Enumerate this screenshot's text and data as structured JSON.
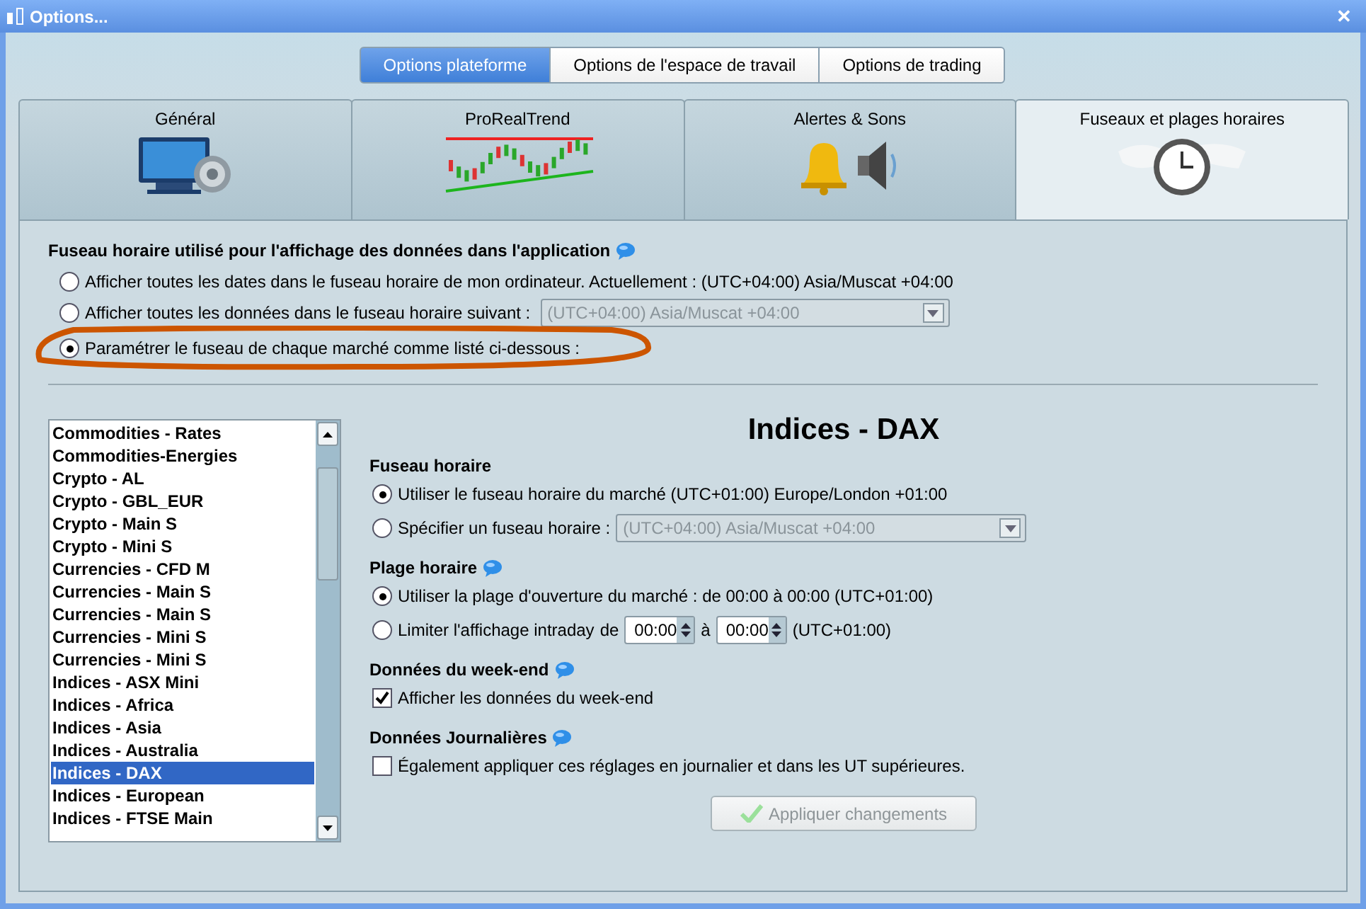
{
  "window": {
    "title": "Options...",
    "close": "✕"
  },
  "platform_tabs": [
    {
      "label": "Options plateforme",
      "selected": true
    },
    {
      "label": "Options de l'espace de travail",
      "selected": false
    },
    {
      "label": "Options de trading",
      "selected": false
    }
  ],
  "category_tabs": [
    {
      "label": "Général",
      "selected": false,
      "kind": "computer"
    },
    {
      "label": "ProRealTrend",
      "selected": false,
      "kind": "trend"
    },
    {
      "label": "Alertes & Sons",
      "selected": false,
      "kind": "sound"
    },
    {
      "label": "Fuseaux et plages horaires",
      "selected": true,
      "kind": "clock"
    }
  ],
  "timezone_section": {
    "heading": "Fuseau horaire utilisé pour l'affichage des données dans l'application",
    "info": true,
    "options": [
      {
        "label": "Afficher toutes les dates dans le fuseau horaire de mon ordinateur. Actuellement : (UTC+04:00) Asia/Muscat +04:00",
        "selected": false
      },
      {
        "label": "Afficher toutes les données dans le fuseau horaire suivant :",
        "selected": false,
        "dropdown": {
          "value": "(UTC+04:00) Asia/Muscat +04:00",
          "disabled": true
        }
      },
      {
        "label": "Paramétrer le fuseau de chaque marché comme listé ci-dessous :",
        "selected": true,
        "annotation": {
          "kind": "ellipse",
          "color": "#cc5500"
        }
      }
    ]
  },
  "market_list": {
    "items": [
      {
        "label": "Commodities - Rates",
        "selected": false
      },
      {
        "label": "Commodities-Energies",
        "selected": false
      },
      {
        "label": "Crypto - AL",
        "selected": false
      },
      {
        "label": "Crypto - GBL_EUR",
        "selected": false
      },
      {
        "label": "Crypto - Main S",
        "selected": false
      },
      {
        "label": "Crypto - Mini S",
        "selected": false
      },
      {
        "label": "Currencies - CFD M",
        "selected": false
      },
      {
        "label": "Currencies - Main S",
        "selected": false
      },
      {
        "label": "Currencies - Main S",
        "selected": false
      },
      {
        "label": "Currencies - Mini S",
        "selected": false
      },
      {
        "label": "Currencies - Mini S",
        "selected": false
      },
      {
        "label": "Indices - ASX Mini",
        "selected": false
      },
      {
        "label": "Indices - Africa",
        "selected": false
      },
      {
        "label": "Indices - Asia",
        "selected": false
      },
      {
        "label": "Indices - Australia",
        "selected": false
      },
      {
        "label": "Indices - DAX",
        "selected": true
      },
      {
        "label": "Indices - European",
        "selected": false
      },
      {
        "label": "Indices - FTSE Main",
        "selected": false
      }
    ]
  },
  "detail": {
    "title": "Indices - DAX",
    "sections": [
      {
        "heading": "Fuseau horaire",
        "controls": [
          {
            "kind": "radio",
            "selected": true,
            "parts": [
              {
                "kind": "text",
                "text": "Utiliser le fuseau horaire du marché (UTC+01:00) Europe/London +01:00"
              }
            ]
          },
          {
            "kind": "radio",
            "selected": false,
            "parts": [
              {
                "kind": "text",
                "text": "Spécifier un fuseau horaire :"
              },
              {
                "kind": "dropdown",
                "value": "(UTC+04:00) Asia/Muscat +04:00",
                "disabled": true
              }
            ]
          }
        ]
      },
      {
        "heading": "Plage horaire",
        "info": true,
        "controls": [
          {
            "kind": "radio",
            "selected": true,
            "parts": [
              {
                "kind": "text",
                "text": "Utiliser la plage d'ouverture du marché : de 00:00 à 00:00  (UTC+01:00)"
              }
            ]
          },
          {
            "kind": "radio",
            "selected": false,
            "parts": [
              {
                "kind": "text",
                "text": "Limiter l'affichage intraday"
              },
              {
                "kind": "text",
                "text": "de"
              },
              {
                "kind": "spinner",
                "value": "00:00"
              },
              {
                "kind": "text",
                "text": "à"
              },
              {
                "kind": "spinner",
                "value": "00:00"
              },
              {
                "kind": "text",
                "text": "(UTC+01:00)"
              }
            ]
          }
        ]
      },
      {
        "heading": "Données du week-end",
        "info": true,
        "controls": [
          {
            "kind": "checkbox",
            "checked": true,
            "parts": [
              {
                "kind": "text",
                "text": "Afficher les données du week-end"
              }
            ]
          }
        ]
      },
      {
        "heading": "Données Journalières",
        "info": true,
        "controls": [
          {
            "kind": "checkbox",
            "checked": false,
            "parts": [
              {
                "kind": "text",
                "text": "Également appliquer ces réglages en journalier et dans les UT supérieures."
              }
            ]
          }
        ]
      }
    ]
  },
  "apply_button": {
    "label": "Appliquer changements",
    "disabled": true
  }
}
